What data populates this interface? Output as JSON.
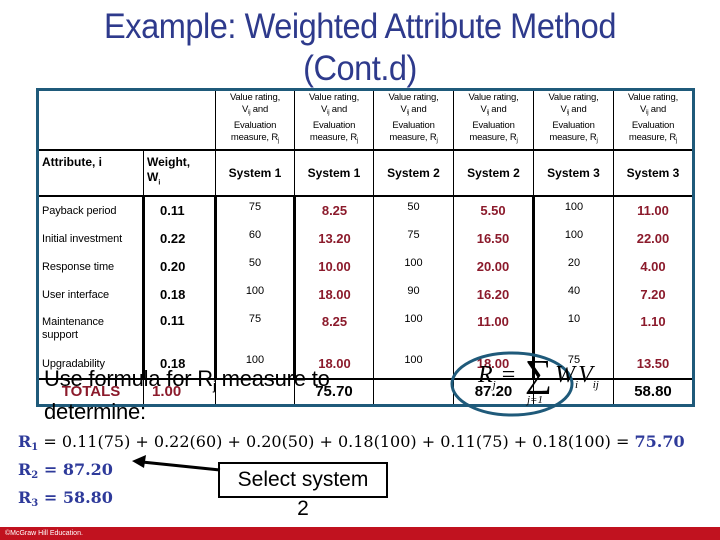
{
  "slide": {
    "title_line1": "Example: Weighted Attribute Method",
    "title_line2": "(Cont.d)"
  },
  "table": {
    "header_note": {
      "line1": "Value rating,",
      "v_label": "V",
      "v_sub": "ij",
      "line2_tail": " and",
      "line3": "Evaluation",
      "line4": "measure, R",
      "r_sub": "j"
    },
    "attribute_header": "Attribute, i",
    "weight_header": "Weight,",
    "weight_symbol": "W",
    "weight_sub": "i",
    "system_headers": [
      "System 1",
      "System 1",
      "System 2",
      "System 2",
      "System 3",
      "System 3"
    ],
    "rows": [
      {
        "attribute": "Payback period",
        "weight": "0.11",
        "v1": "75",
        "r1": "8.25",
        "v2": "50",
        "r2": "5.50",
        "v3": "100",
        "r3": "11.00"
      },
      {
        "attribute": "Initial investment",
        "weight": "0.22",
        "v1": "60",
        "r1": "13.20",
        "v2": "75",
        "r2": "16.50",
        "v3": "100",
        "r3": "22.00"
      },
      {
        "attribute": "Response time",
        "weight": "0.20",
        "v1": "50",
        "r1": "10.00",
        "v2": "100",
        "r2": "20.00",
        "v3": "20",
        "r3": "4.00"
      },
      {
        "attribute": "User interface",
        "weight": "0.18",
        "v1": "100",
        "r1": "18.00",
        "v2": "90",
        "r2": "16.20",
        "v3": "40",
        "r3": "7.20"
      },
      {
        "attribute": "Maintenance support",
        "weight": "0.11",
        "v1": "75",
        "r1": "8.25",
        "v2": "100",
        "r2": "11.00",
        "v3": "10",
        "r3": "1.10"
      },
      {
        "attribute": "Upgradability",
        "weight": "0.18",
        "v1": "100",
        "r1": "18.00",
        "v2": "100",
        "r2": "18.00",
        "v3": "75",
        "r3": "13.50"
      }
    ],
    "totals": {
      "label": "TOTALS",
      "weight": "1.00",
      "r1": "75.70",
      "r2": "87.20",
      "r3": "58.80"
    }
  },
  "instruction": {
    "text_before": "Use formula for R",
    "sub": "j",
    "text_after": " measure to",
    "line2": "determine:"
  },
  "formula": {
    "lhs": "R",
    "lhs_sub": "j",
    "equals": "=",
    "sigma": "∑",
    "sigma_sub": "j=1",
    "rhs_w": "W",
    "rhs_w_sub": "i",
    "rhs_v": "V",
    "rhs_v_sub": "ij"
  },
  "equations": [
    {
      "label": "R",
      "sub": "1",
      "expr": " = 0.11(75) + 0.22(60) + 0.20(50) + 0.18(100) + 0.11(75)  +  0.18(100) = ",
      "result": "75.70"
    },
    {
      "label": "R",
      "sub": "2",
      "expr": "  =  ",
      "result": "87.20"
    },
    {
      "label": "R",
      "sub": "3",
      "expr": "  =  ",
      "result": "58.80"
    }
  ],
  "callout": {
    "line1": "Select  system",
    "line2": "2"
  },
  "footer": {
    "copyright": "©McGraw Hill Education."
  },
  "colors": {
    "title": "#2e3a8c",
    "table_border": "#1f5a7a",
    "computed_values": "#8b1a2b",
    "equation_labels": "#2e3a9a",
    "footer_bar": "#c1121f"
  }
}
